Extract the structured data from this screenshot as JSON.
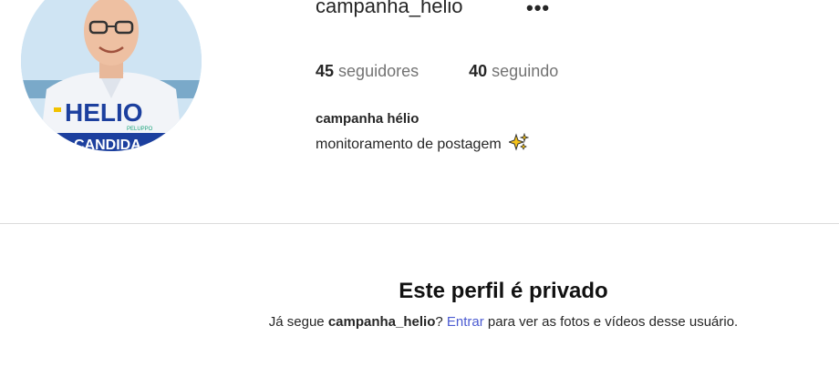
{
  "profile": {
    "username": "campanha_helio",
    "more_icon": "more-horizontal-icon",
    "followers_count": "45",
    "followers_label": "seguidores",
    "following_count": "40",
    "following_label": "seguindo",
    "display_name": "campanha hélio",
    "bio": "monitoramento de postagem",
    "bio_emoji": "sparkles-icon",
    "avatar_text": {
      "logo": "HELIO",
      "logo_sub": "PELUPPO",
      "banner": "CANDIDA"
    }
  },
  "private": {
    "title": "Este perfil é privado",
    "prefix": "Já segue ",
    "username": "campanha_helio",
    "question": "? ",
    "login_link": "Entrar",
    "suffix": " para ver as fotos e vídeos desse usuário."
  },
  "colors": {
    "link": "#4b5bd1",
    "muted": "#737373",
    "divider": "#dbdbdb"
  }
}
